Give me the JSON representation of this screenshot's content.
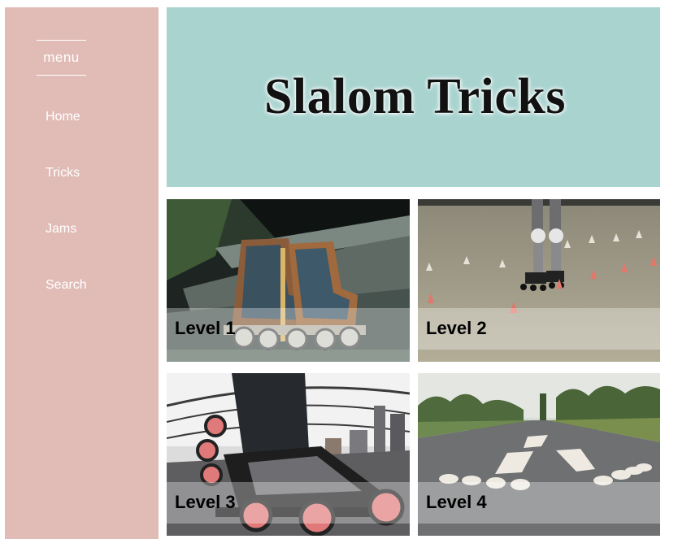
{
  "sidebar": {
    "menu_label": "menu",
    "items": [
      {
        "label": "Home"
      },
      {
        "label": "Tricks"
      },
      {
        "label": "Jams"
      },
      {
        "label": "Search"
      }
    ]
  },
  "hero": {
    "title": "Slalom Tricks"
  },
  "tiles": [
    {
      "label": "Level 1"
    },
    {
      "label": "Level 2"
    },
    {
      "label": "Level 3"
    },
    {
      "label": "Level 4"
    }
  ],
  "colors": {
    "sidebar_bg": "#e1bcb7",
    "hero_bg": "#a8d3cf",
    "text_light": "#ffffff"
  }
}
